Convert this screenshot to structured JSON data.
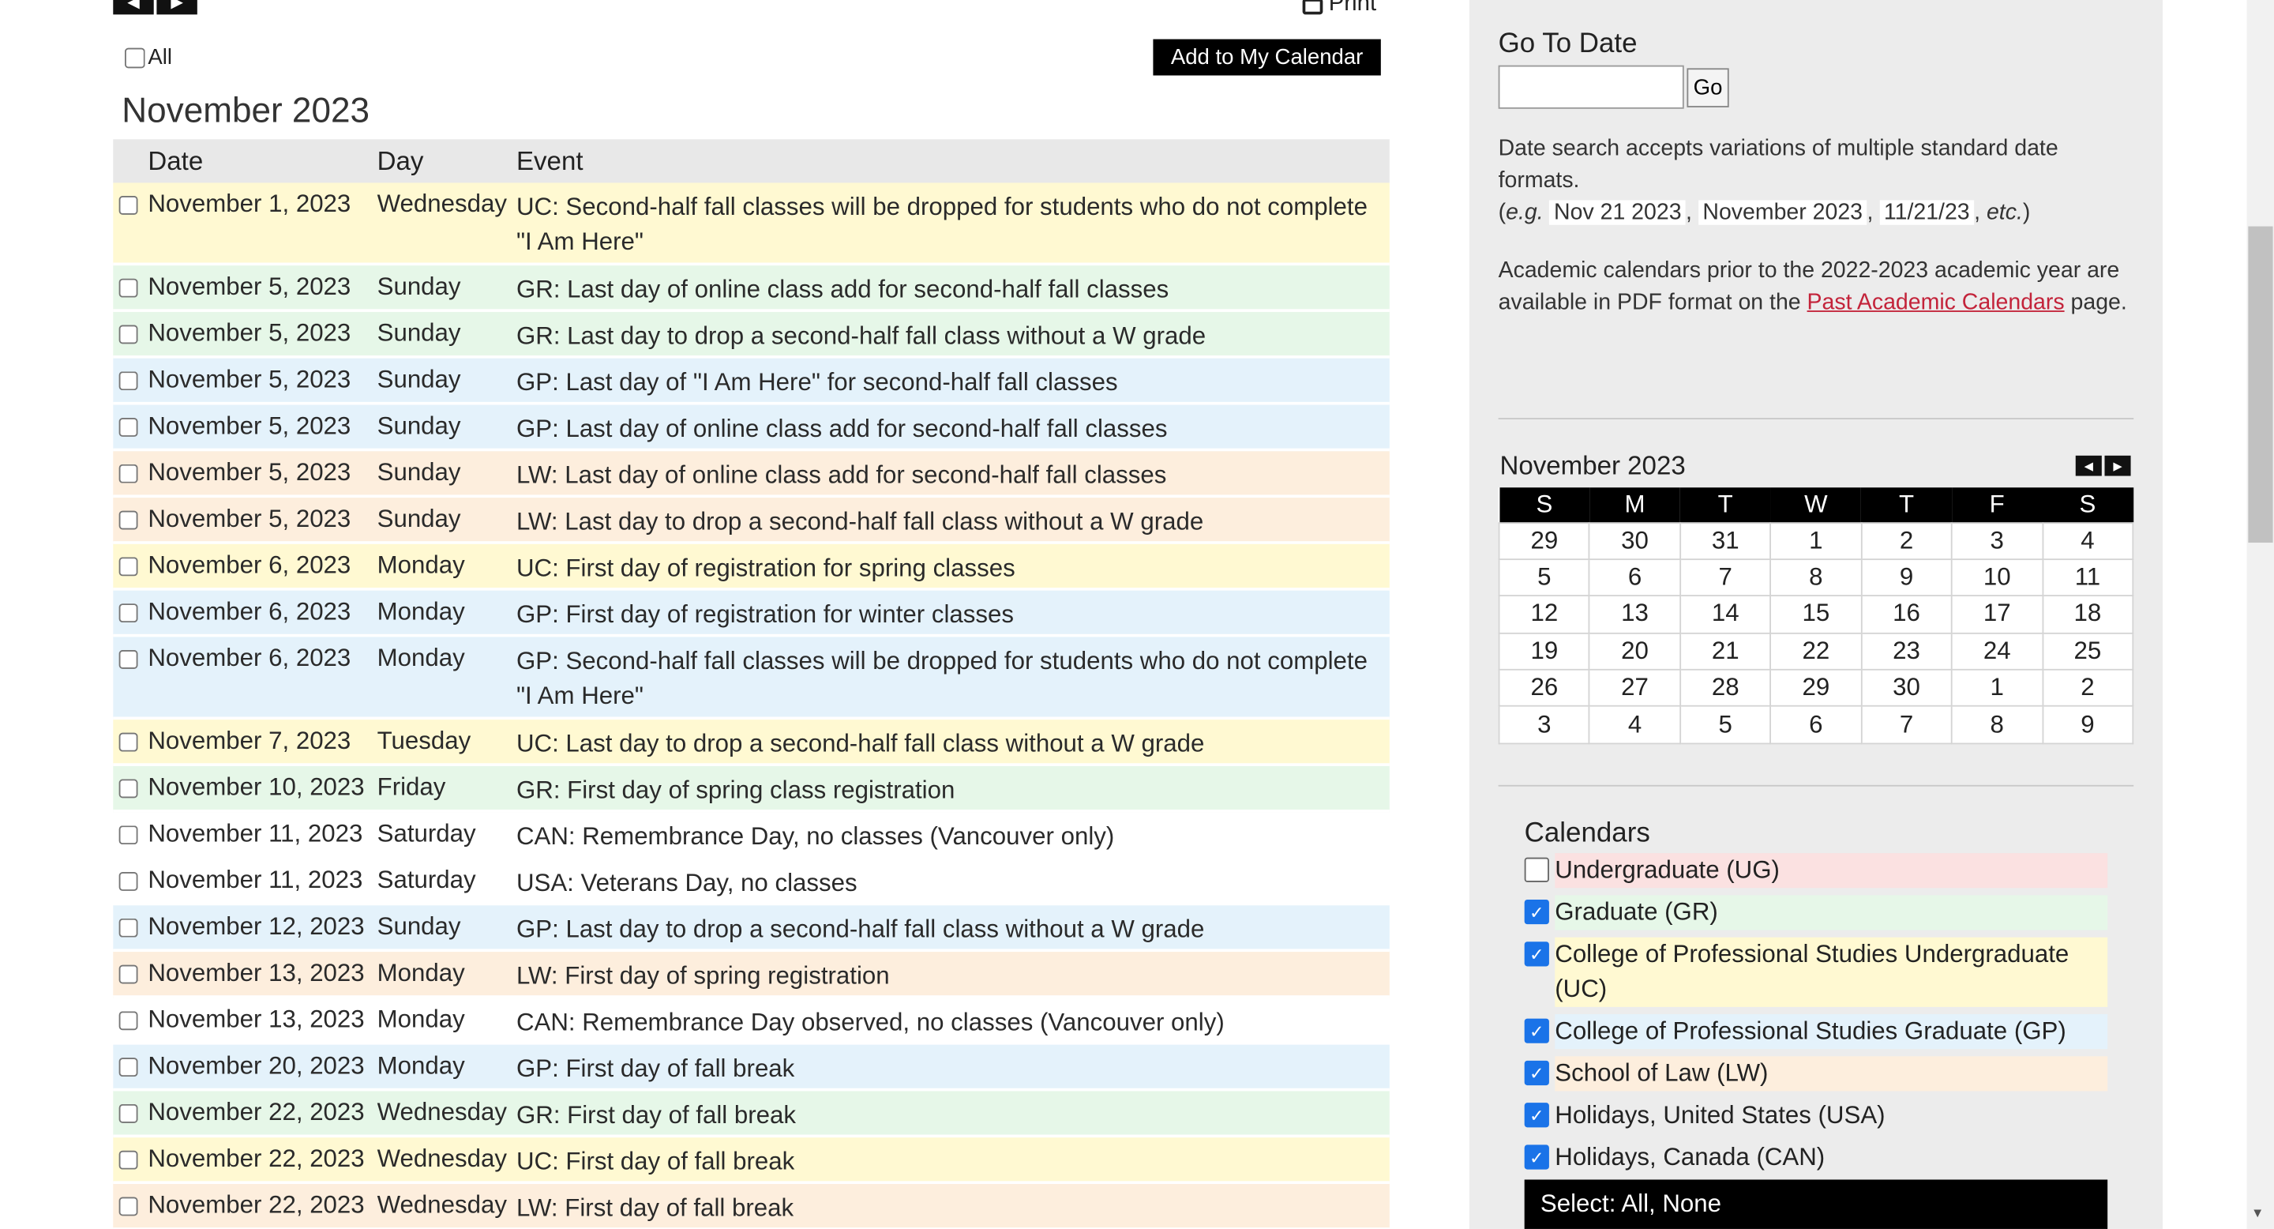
{
  "toolbar": {
    "print_label": "Print",
    "all_label": "All",
    "add_calendar_label": "Add to My Calendar"
  },
  "month_title": "November 2023",
  "table": {
    "headers": {
      "date": "Date",
      "day": "Day",
      "event": "Event"
    },
    "rows": [
      {
        "date": "November 1, 2023",
        "day": "Wednesday",
        "event": "UC: Second-half fall classes will be dropped for students who do not complete \"I Am Here\"",
        "cat": "uc"
      },
      {
        "date": "November 5, 2023",
        "day": "Sunday",
        "event": "GR: Last day of online class add for second-half fall classes",
        "cat": "gr"
      },
      {
        "date": "November 5, 2023",
        "day": "Sunday",
        "event": "GR: Last day to drop a second-half fall class without a W grade",
        "cat": "gr"
      },
      {
        "date": "November 5, 2023",
        "day": "Sunday",
        "event": "GP: Last day of \"I Am Here\" for second-half fall classes",
        "cat": "gp"
      },
      {
        "date": "November 5, 2023",
        "day": "Sunday",
        "event": "GP: Last day of online class add for second-half fall classes",
        "cat": "gp"
      },
      {
        "date": "November 5, 2023",
        "day": "Sunday",
        "event": "LW: Last day of online class add for second-half fall classes",
        "cat": "lw"
      },
      {
        "date": "November 5, 2023",
        "day": "Sunday",
        "event": "LW: Last day to drop a second-half fall class without a W grade",
        "cat": "lw"
      },
      {
        "date": "November 6, 2023",
        "day": "Monday",
        "event": "UC: First day of registration for spring classes",
        "cat": "uc"
      },
      {
        "date": "November 6, 2023",
        "day": "Monday",
        "event": "GP: First day of registration for winter classes",
        "cat": "gp"
      },
      {
        "date": "November 6, 2023",
        "day": "Monday",
        "event": "GP: Second-half fall classes will be dropped for students who do not complete \"I Am Here\"",
        "cat": "gp"
      },
      {
        "date": "November 7, 2023",
        "day": "Tuesday",
        "event": "UC: Last day to drop a second-half fall class without a W grade",
        "cat": "uc"
      },
      {
        "date": "November 10, 2023",
        "day": "Friday",
        "event": "GR: First day of spring class registration",
        "cat": "gr"
      },
      {
        "date": "November 11, 2023",
        "day": "Saturday",
        "event": "CAN: Remembrance Day, no classes (Vancouver only)",
        "cat": "none"
      },
      {
        "date": "November 11, 2023",
        "day": "Saturday",
        "event": "USA: Veterans Day, no classes",
        "cat": "none"
      },
      {
        "date": "November 12, 2023",
        "day": "Sunday",
        "event": "GP: Last day to drop a second-half fall class without a W grade",
        "cat": "gp"
      },
      {
        "date": "November 13, 2023",
        "day": "Monday",
        "event": "LW: First day of spring registration",
        "cat": "lw"
      },
      {
        "date": "November 13, 2023",
        "day": "Monday",
        "event": "CAN: Remembrance Day observed, no classes (Vancouver only)",
        "cat": "none"
      },
      {
        "date": "November 20, 2023",
        "day": "Monday",
        "event": "GP: First day of fall break",
        "cat": "gp"
      },
      {
        "date": "November 22, 2023",
        "day": "Wednesday",
        "event": "GR: First day of fall break",
        "cat": "gr"
      },
      {
        "date": "November 22, 2023",
        "day": "Wednesday",
        "event": "UC: First day of fall break",
        "cat": "uc"
      },
      {
        "date": "November 22, 2023",
        "day": "Wednesday",
        "event": "LW: First day of fall break",
        "cat": "lw"
      }
    ]
  },
  "sidebar": {
    "goto_title": "Go To Date",
    "go_button": "Go",
    "help_text_1": "Date search accepts variations of multiple standard date formats.",
    "help_eg": "e.g.",
    "help_ex1": "Nov 21 2023",
    "help_ex2": "November 2023",
    "help_ex3": "11/21/23",
    "help_etc": "etc.",
    "past_text_1": "Academic calendars prior to the 2022-2023 academic year are available in PDF format on the",
    "past_link": "Past Academic Calendars",
    "past_text_2": "page.",
    "mini_calendar": {
      "title": "November 2023",
      "weekdays": [
        "S",
        "M",
        "T",
        "W",
        "T",
        "F",
        "S"
      ],
      "weeks": [
        [
          "29",
          "30",
          "31",
          "1",
          "2",
          "3",
          "4"
        ],
        [
          "5",
          "6",
          "7",
          "8",
          "9",
          "10",
          "11"
        ],
        [
          "12",
          "13",
          "14",
          "15",
          "16",
          "17",
          "18"
        ],
        [
          "19",
          "20",
          "21",
          "22",
          "23",
          "24",
          "25"
        ],
        [
          "26",
          "27",
          "28",
          "29",
          "30",
          "1",
          "2"
        ],
        [
          "3",
          "4",
          "5",
          "6",
          "7",
          "8",
          "9"
        ]
      ]
    },
    "calendars_title": "Calendars",
    "calendars": [
      {
        "label": "Undergraduate (UG)",
        "checked": false,
        "cat": "ug"
      },
      {
        "label": "Graduate (GR)",
        "checked": true,
        "cat": "gr"
      },
      {
        "label": "College of Professional Studies Undergraduate (UC)",
        "checked": true,
        "cat": "uc"
      },
      {
        "label": "College of Professional Studies Graduate (GP)",
        "checked": true,
        "cat": "gp"
      },
      {
        "label": "School of Law (LW)",
        "checked": true,
        "cat": "lw"
      },
      {
        "label": "Holidays, United States (USA)",
        "checked": true,
        "cat": "none"
      },
      {
        "label": "Holidays, Canada (CAN)",
        "checked": true,
        "cat": "none"
      }
    ],
    "select_bar": "Select: All, None"
  },
  "colors": {
    "uc": "#fff9d2",
    "gr": "#e6f7e8",
    "gp": "#e4f2fb",
    "lw": "#fdeedd",
    "ug": "#fbe1e1",
    "link": "#c3233a"
  }
}
